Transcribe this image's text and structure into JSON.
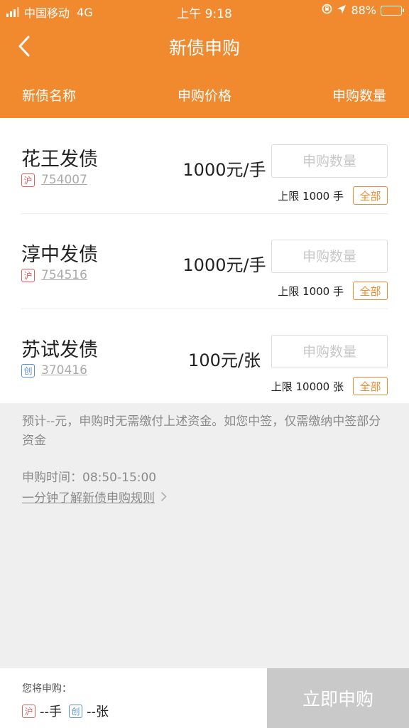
{
  "status_bar": {
    "carrier": "中国移动",
    "network": "4G",
    "time": "上午 9:18",
    "battery": "88%",
    "battery_level": 0.88,
    "icons": [
      "signal-icon",
      "orientation-lock-icon",
      "location-arrow-icon",
      "battery-icon"
    ]
  },
  "header": {
    "title": "新债申购",
    "back_icon": "chevron-left-icon"
  },
  "columns": {
    "name": "新债名称",
    "price": "申购价格",
    "quantity": "申购数量"
  },
  "bonds": [
    {
      "name": "花王发债",
      "market": "沪",
      "market_color": "#e06060",
      "code": "754007",
      "price": "1000元/手",
      "placeholder": "申购数量",
      "limit": "上限 1000 手",
      "all_label": "全部"
    },
    {
      "name": "淳中发债",
      "market": "沪",
      "market_color": "#e06060",
      "code": "754516",
      "price": "1000元/手",
      "placeholder": "申购数量",
      "limit": "上限 1000 手",
      "all_label": "全部"
    },
    {
      "name": "苏试发债",
      "market": "创",
      "market_color": "#5b8fd6",
      "code": "370416",
      "price": "100元/张",
      "placeholder": "申购数量",
      "limit": "上限 10000 张",
      "all_label": "全部"
    }
  ],
  "notes": {
    "estimate": "预计--元，申购时无需缴付上述资金。如您中签，仅需缴纳中签部分资金",
    "time": "申购时间：08:50-15:00",
    "rules_link": "一分钟了解新债申购规则"
  },
  "bottom": {
    "label": "您将申购：",
    "sh_market": "沪",
    "sh_amount": "--手",
    "cy_market": "创",
    "cy_amount": "--张",
    "submit_label": "立即申购"
  },
  "colors": {
    "accent": "#f18a2f",
    "sh_market": "#e06060",
    "cy_market": "#5b8fd6",
    "submit_disabled": "#c9c9c9"
  }
}
